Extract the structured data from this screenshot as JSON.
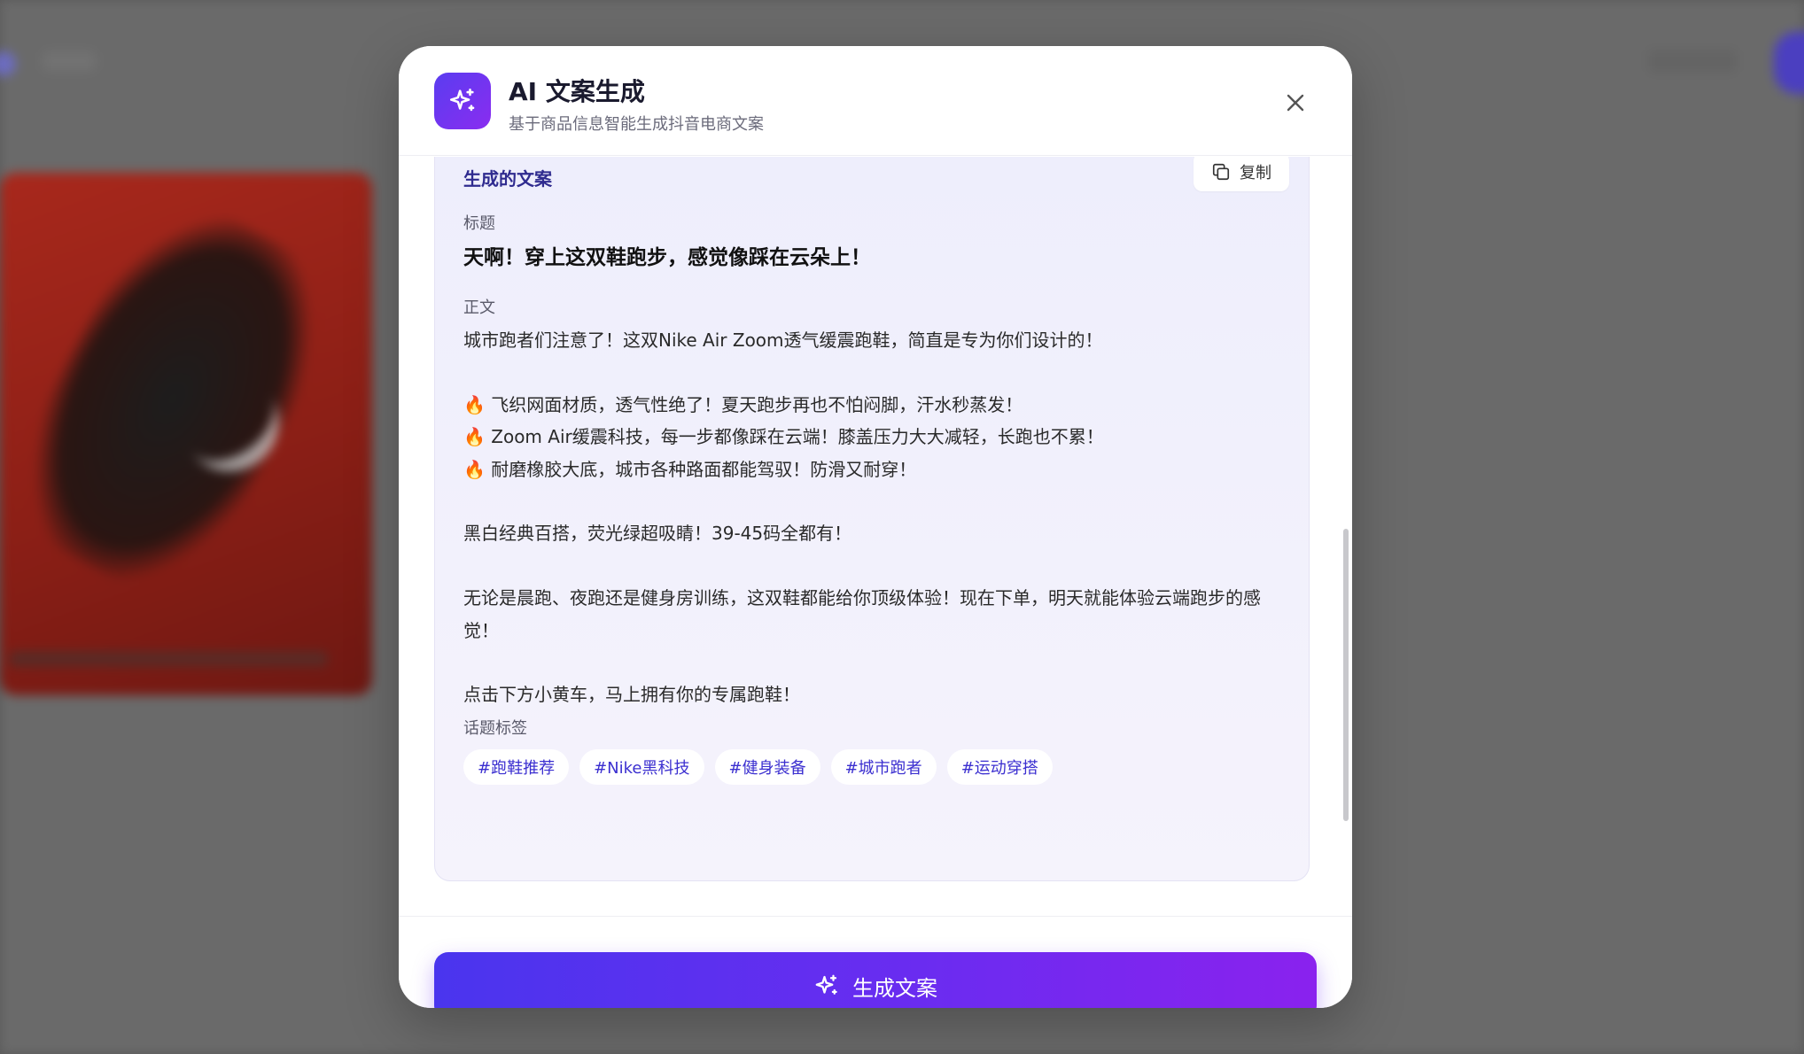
{
  "dialog": {
    "title": "AI 文案生成",
    "subtitle": "基于商品信息智能生成抖音电商文案",
    "icon": "sparkles-icon",
    "close_icon": "close-icon"
  },
  "result": {
    "heading": "生成的文案",
    "copy_label": "复制",
    "title_label": "标题",
    "title": "天啊！穿上这双鞋跑步，感觉像踩在云朵上！",
    "body_label": "正文",
    "body": "城市跑者们注意了！这双Nike Air Zoom透气缓震跑鞋，简直是专为你们设计的！\n\n🔥 飞织网面材质，透气性绝了！夏天跑步再也不怕闷脚，汗水秒蒸发！\n🔥 Zoom Air缓震科技，每一步都像踩在云端！膝盖压力大大减轻，长跑也不累！\n🔥 耐磨橡胶大底，城市各种路面都能驾驭！防滑又耐穿！\n\n黑白经典百搭，荧光绿超吸睛！39-45码全都有！\n\n无论是晨跑、夜跑还是健身房训练，这双鞋都能给你顶级体验！现在下单，明天就能体验云端跑步的感觉！\n\n点击下方小黄车，马上拥有你的专属跑鞋！",
    "tags_label": "话题标签",
    "tags": [
      "#跑鞋推荐",
      "#Nike黑科技",
      "#健身装备",
      "#城市跑者",
      "#运动穿搭"
    ]
  },
  "footer": {
    "generate_label": "生成文案"
  },
  "colors": {
    "accent_start": "#4a35ee",
    "accent_end": "#8a22ee",
    "tag_text": "#3b2fd0"
  }
}
